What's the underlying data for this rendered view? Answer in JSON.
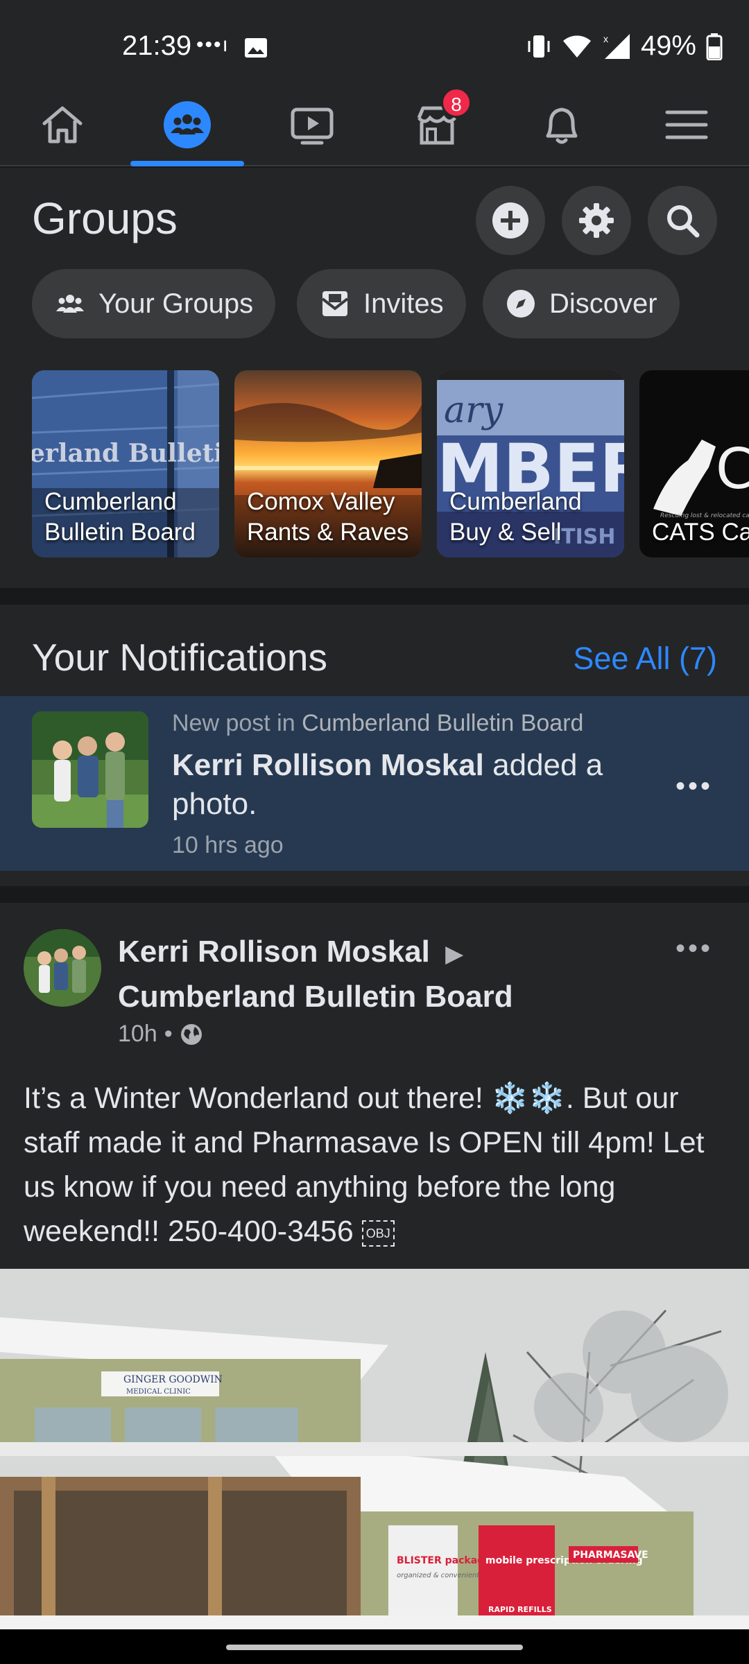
{
  "status_bar": {
    "time": "21:39",
    "dots": "•••ı",
    "battery": "49%"
  },
  "nav": {
    "items": [
      {
        "icon": "home-icon"
      },
      {
        "icon": "groups-icon",
        "active": true
      },
      {
        "icon": "watch-icon"
      },
      {
        "icon": "marketplace-icon",
        "badge": "8"
      },
      {
        "icon": "bell-icon"
      },
      {
        "icon": "menu-icon"
      }
    ],
    "marketplace_badge": "8"
  },
  "groups": {
    "title": "Groups",
    "pills": [
      {
        "label": "Your Groups",
        "icon": "people-icon"
      },
      {
        "label": "Invites",
        "icon": "invite-icon"
      },
      {
        "label": "Discover",
        "icon": "compass-icon"
      }
    ],
    "cards": [
      {
        "label": "Cumberland Bulletin Board",
        "overlay": "erland Bulletin"
      },
      {
        "label": "Comox Valley Rants & Raves"
      },
      {
        "label": "Cumberland Buy & Sell",
        "overlay_top": "ary",
        "overlay_mid": "MBERLA",
        "overlay_bottom": "ITISH"
      },
      {
        "label": "CATS Ca Advocate",
        "overlay_mid": "Ca",
        "overlay_small": "Rescuing lost & relocated cats"
      }
    ]
  },
  "notifications": {
    "title": "Your Notifications",
    "see_all": "See All (7)",
    "item": {
      "meta_prefix": "New post in",
      "group": "Cumberland Bulletin Board",
      "actor": "Kerri Rollison Moskal",
      "action": "added a photo.",
      "time": "10 hrs ago",
      "more": "•••"
    }
  },
  "post": {
    "author": "Kerri Rollison Moskal",
    "arrow": "▶",
    "group": "Cumberland Bulletin Board",
    "time": "10h",
    "separator": "•",
    "more": "•••",
    "body": "It’s a Winter Wonderland out there! ❄️❄️.  But our staff made it and Pharmasave Is OPEN till 4pm!  Let us know if you need anything before the long weekend!! 250-400-3456",
    "obj_mark": "OBJ",
    "image_signs": {
      "clinic": "GINGER GOODWIN",
      "clinic_sub": "MEDICAL CLINIC",
      "store": "PHARMASAVE",
      "window1": "BLISTER packaging",
      "window1_sub": "organized & convenient",
      "window2": "mobile prescription ordering",
      "window2_sub": "RAPID REFILLS"
    }
  },
  "colors": {
    "accent": "#2d88ff",
    "badge": "#f02849",
    "surface": "#242526",
    "background": "#18191a",
    "notif_highlight": "#263951"
  }
}
